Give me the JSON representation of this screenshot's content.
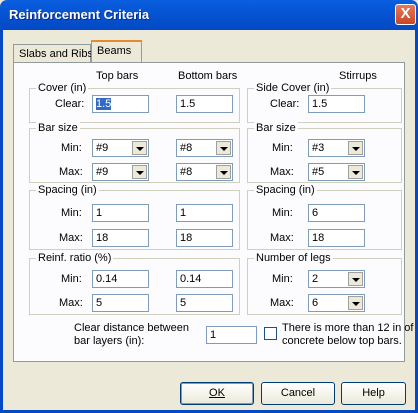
{
  "window": {
    "title": "Reinforcement Criteria",
    "close_glyph": "X"
  },
  "tabs": [
    {
      "label": "Slabs and Ribs"
    },
    {
      "label": "Beams"
    }
  ],
  "columns": {
    "top": "Top bars",
    "bottom": "Bottom bars",
    "stirrups": "Stirrups"
  },
  "cover": {
    "title": "Cover (in)",
    "clear_label": "Clear:",
    "top": "1.5",
    "bottom": "1.5"
  },
  "bar_size": {
    "title": "Bar size",
    "min_label": "Min:",
    "max_label": "Max:",
    "top_min": "#9",
    "top_max": "#9",
    "bottom_min": "#8",
    "bottom_max": "#8"
  },
  "spacing": {
    "title": "Spacing (in)",
    "min_label": "Min:",
    "max_label": "Max:",
    "top_min": "1",
    "top_max": "18",
    "bottom_min": "1",
    "bottom_max": "18"
  },
  "reinf_ratio": {
    "title": "Reinf. ratio (%)",
    "min_label": "Min:",
    "max_label": "Max:",
    "top_min": "0.14",
    "top_max": "5",
    "bottom_min": "0.14",
    "bottom_max": "5"
  },
  "stirrups": {
    "side_cover": {
      "title": "Side Cover (in)",
      "clear_label": "Clear:",
      "value": "1.5"
    },
    "bar_size": {
      "title": "Bar size",
      "min_label": "Min:",
      "max_label": "Max:",
      "min": "#3",
      "max": "#5"
    },
    "spacing": {
      "title": "Spacing (in)",
      "min_label": "Min:",
      "max_label": "Max:",
      "min": "6",
      "max": "18"
    },
    "legs": {
      "title": "Number of legs",
      "min_label": "Min:",
      "max_label": "Max:",
      "min": "2",
      "max": "6"
    }
  },
  "clear_distance": {
    "label_line1": "Clear distance between",
    "label_line2": "bar layers (in):",
    "value": "1"
  },
  "concrete_check": {
    "line1": "There is more than 12 in of",
    "line2": "concrete below top bars.",
    "checked": false
  },
  "buttons": {
    "ok": "OK",
    "cancel": "Cancel",
    "help": "Help"
  },
  "icons": {
    "dropdown": "chevron-down-icon",
    "close": "close-icon"
  }
}
